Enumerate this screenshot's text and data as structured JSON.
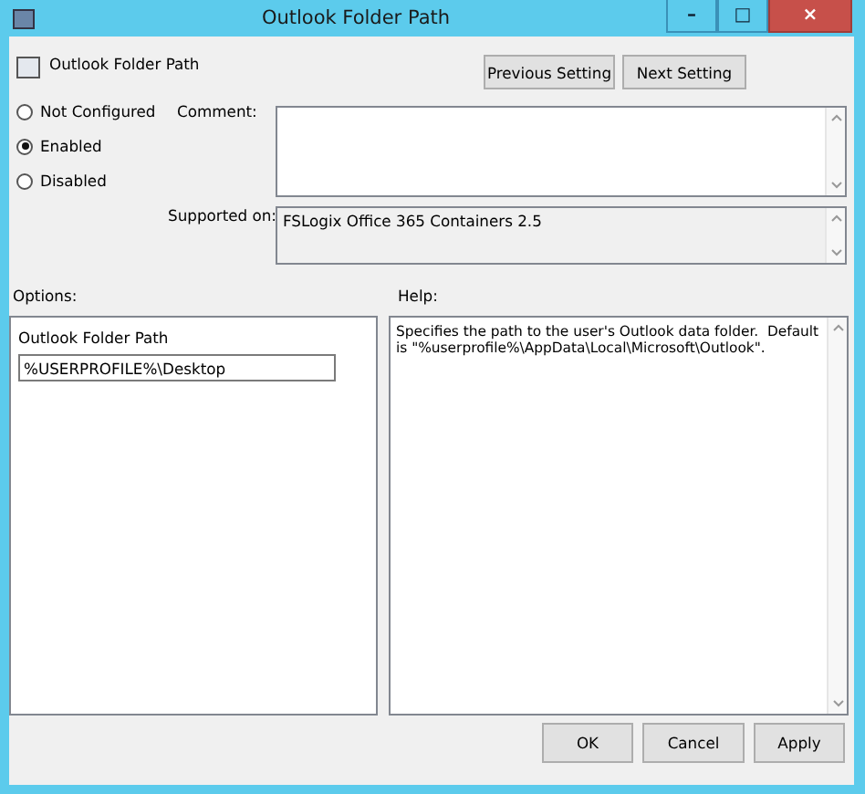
{
  "window": {
    "title": "Outlook Folder Path",
    "controls": [
      "–",
      "□",
      "×"
    ]
  },
  "header": {
    "title": "Outlook Folder Path",
    "buttons": [
      "Previous Setting",
      "Next Setting"
    ]
  },
  "state_options": [
    {
      "label": "Not Configured",
      "selected": false
    },
    {
      "label": "Enabled",
      "selected": true
    },
    {
      "label": "Disabled",
      "selected": false
    }
  ],
  "comment": {
    "label": "Comment:"
  },
  "supported_on": {
    "label": "Supported on:",
    "value": "FSLogix Office 365 Containers 2.5"
  },
  "options": {
    "label": "Options:",
    "field_label": "Outlook Folder Path",
    "value": "%USERPROFILE%\\Desktop"
  },
  "help": {
    "label": "Help:",
    "text": "Specifies the path to the user's Outlook data folder.  Default is \"%userprofile%\\AppData\\Local\\Microsoft\\Outlook\"."
  },
  "buttons": [
    "OK",
    "Cancel",
    "Apply"
  ]
}
